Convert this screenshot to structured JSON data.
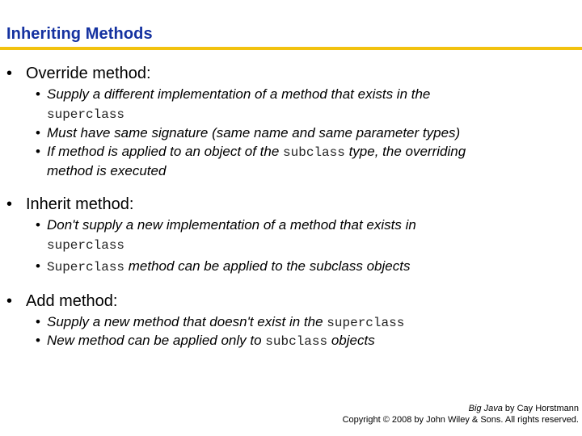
{
  "slide": {
    "title": "Inheriting Methods",
    "accent_color": "#f2c20f",
    "title_color": "#1431a0"
  },
  "sections": [
    {
      "heading": "Override method:",
      "bullets": [
        {
          "text_a": "Supply a different implementation of a method that exists in the",
          "code_cont": "superclass"
        },
        {
          "text_a": "Must have same signature (same name and same parameter types)"
        },
        {
          "text_a": "If method is applied to an object of the ",
          "code": "subclass",
          "text_b": " type, the overriding",
          "cont": "method is executed"
        }
      ]
    },
    {
      "heading": "Inherit method:",
      "bullets": [
        {
          "text_a": "Don't supply a new implementation of a method that exists in",
          "code_cont": "superclass"
        },
        {
          "code": "Superclass",
          "text_b": " method can be applied to the subclass objects"
        }
      ]
    },
    {
      "heading": "Add method:",
      "bullets": [
        {
          "text_a": "Supply a new method that doesn't exist in the ",
          "code": "superclass"
        },
        {
          "text_a": "New method can be applied only to ",
          "code": "subclass",
          "text_b": " objects"
        }
      ]
    }
  ],
  "footer": {
    "book": "Big Java",
    "author": " by Cay Horstmann",
    "copyright": "Copyright © 2008 by John Wiley & Sons.  All rights reserved."
  },
  "bullet_glyph": "•"
}
